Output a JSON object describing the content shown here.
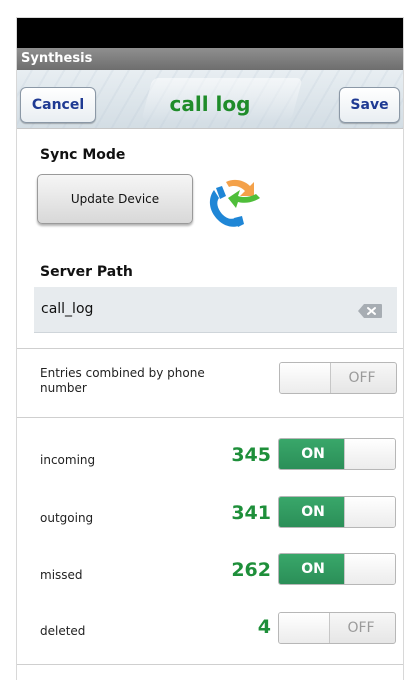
{
  "app": {
    "name": "Synthesis"
  },
  "header": {
    "cancel_label": "Cancel",
    "title": "call log",
    "save_label": "Save"
  },
  "sync_mode": {
    "label": "Sync Mode",
    "button_label": "Update Device"
  },
  "server_path": {
    "label": "Server Path",
    "value": "call_log"
  },
  "combined": {
    "label_line1": "Entries combined by phone",
    "label_line2": "number",
    "state": "OFF"
  },
  "rows": [
    {
      "label": "incoming",
      "count": "345",
      "state": "ON"
    },
    {
      "label": "outgoing",
      "count": "341",
      "state": "ON"
    },
    {
      "label": "missed",
      "count": "262",
      "state": "ON"
    },
    {
      "label": "deleted",
      "count": "4",
      "state": "OFF"
    }
  ],
  "colors": {
    "accent_green": "#1f8c2a",
    "toggle_on": "#2e9a5e",
    "button_text": "#1f3a93"
  },
  "icons": [
    "phone-sync-icon",
    "clear-text-icon"
  ]
}
